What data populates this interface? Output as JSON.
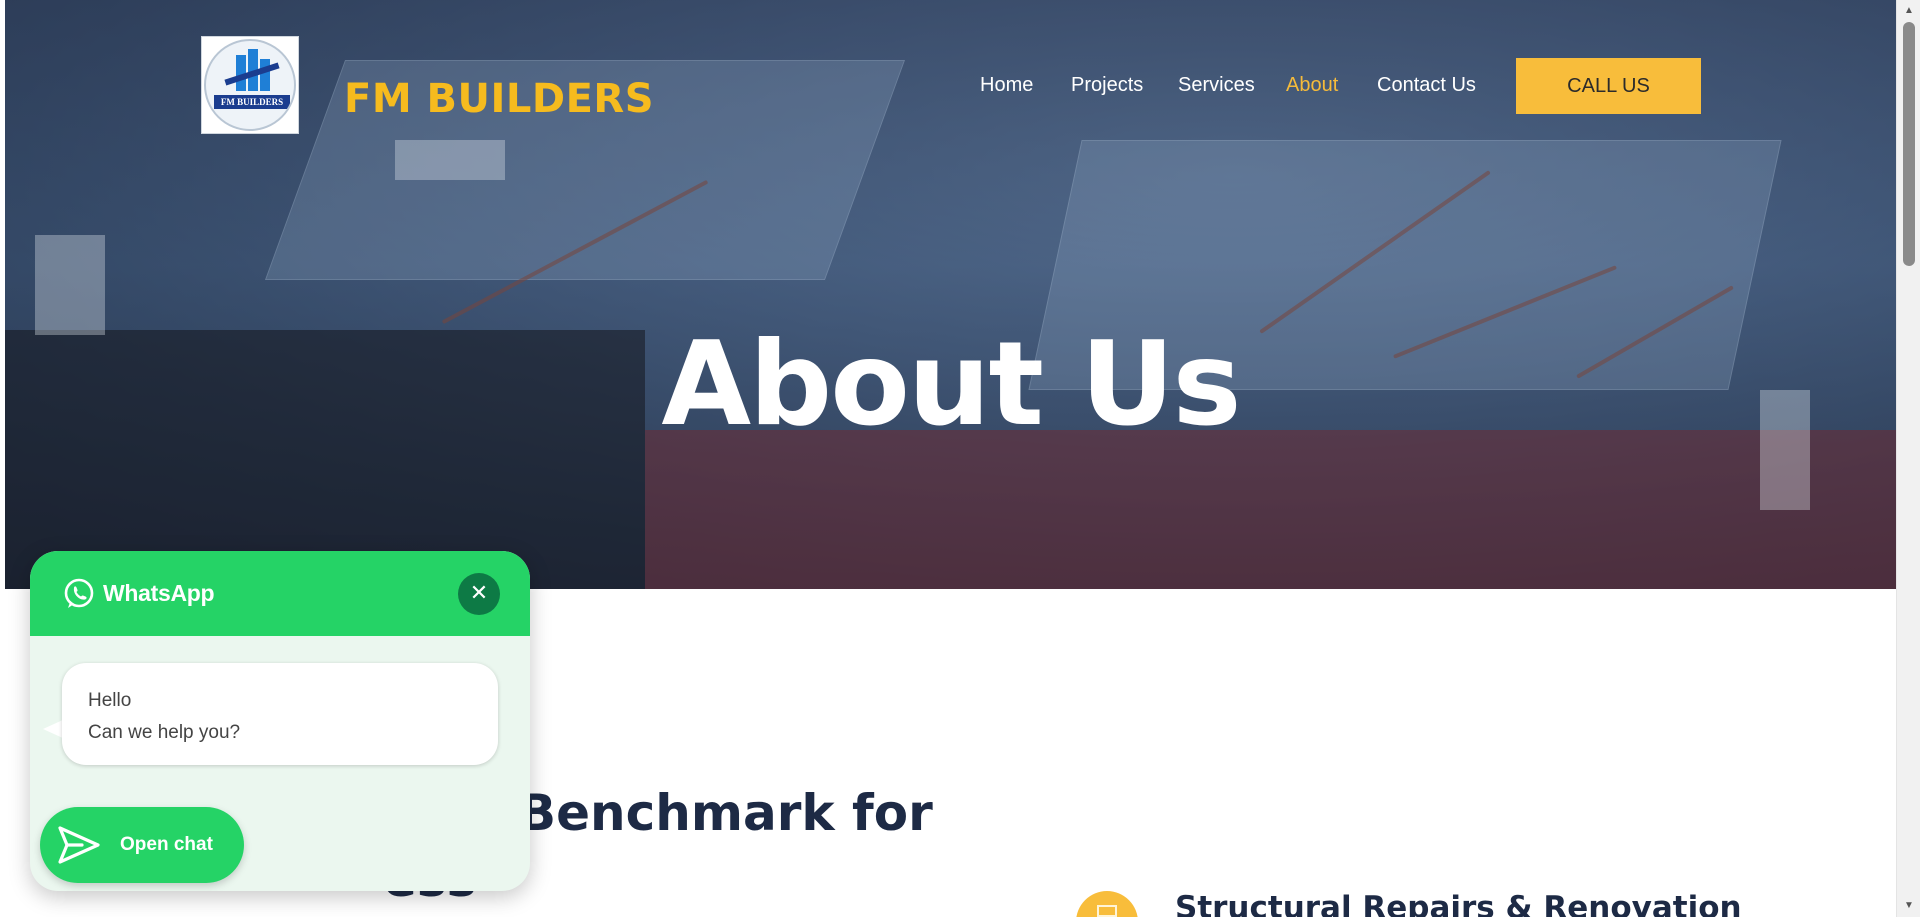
{
  "header": {
    "brand": "FM BUILDERS",
    "logo_text": "FM BUILDERS",
    "nav": {
      "home": "Home",
      "projects": "Projects",
      "services": "Services",
      "about": "About",
      "contact": "Contact Us"
    },
    "active_nav": "About",
    "call_button": "CALL US"
  },
  "hero": {
    "title": "About Us"
  },
  "section": {
    "heading": "Benchmark for",
    "heading_line2": "ess"
  },
  "feature": {
    "title": "Structural Repairs & Renovation"
  },
  "whatsapp": {
    "title": "WhatsApp",
    "message_line1": "Hello",
    "message_line2": "Can we help you?",
    "open_chat": "Open chat",
    "close_symbol": "✕"
  },
  "colors": {
    "accent": "#f8bd3b",
    "brand_text": "#f6bb1e",
    "whatsapp_green": "#25d366",
    "whatsapp_dark": "#0d7a45",
    "heading_text": "#1d2a45"
  },
  "icons": {
    "whatsapp": "whatsapp-icon",
    "close": "close-icon",
    "send": "send-icon",
    "feature": "building-icon"
  }
}
